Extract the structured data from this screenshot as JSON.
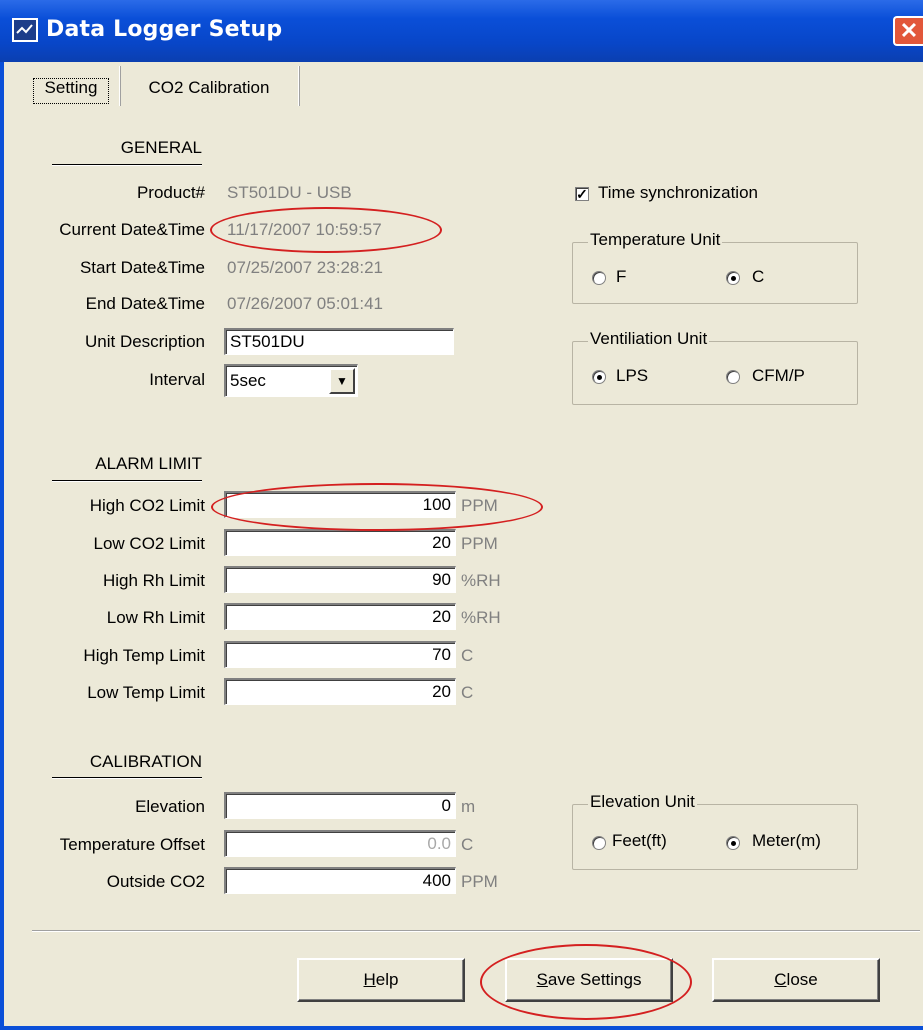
{
  "window": {
    "title": "Data Logger Setup",
    "close_glyph": "✕"
  },
  "tabs": [
    {
      "label": "Setting"
    },
    {
      "label": "CO2 Calibration"
    }
  ],
  "general": {
    "header": "GENERAL",
    "product_label": "Product#",
    "product_value": "ST501DU - USB",
    "current_label": "Current Date&Time",
    "current_value": "11/17/2007 10:59:57",
    "start_label": "Start Date&Time",
    "start_value": "07/25/2007 23:28:21",
    "end_label": "End Date&Time",
    "end_value": "07/26/2007 05:01:41",
    "unit_desc_label": "Unit Description",
    "unit_desc_value": "ST501DU",
    "interval_label": "Interval",
    "interval_value": "5sec"
  },
  "alarm": {
    "header": "ALARM LIMIT",
    "rows": [
      {
        "label": "High CO2 Limit",
        "value": "100",
        "unit": "PPM"
      },
      {
        "label": "Low CO2 Limit",
        "value": "20",
        "unit": "PPM"
      },
      {
        "label": "High Rh Limit",
        "value": "90",
        "unit": "%RH"
      },
      {
        "label": "Low Rh Limit",
        "value": "20",
        "unit": "%RH"
      },
      {
        "label": "High Temp Limit",
        "value": "70",
        "unit": "C"
      },
      {
        "label": "Low Temp Limit",
        "value": "20",
        "unit": "C"
      }
    ]
  },
  "calibration": {
    "header": "CALIBRATION",
    "rows": [
      {
        "label": "Elevation",
        "value": "0",
        "unit": "m"
      },
      {
        "label": "Temperature Offset",
        "value": "0.0",
        "unit": "C"
      },
      {
        "label": "Outside CO2",
        "value": "400",
        "unit": "PPM"
      }
    ]
  },
  "options": {
    "time_sync_label": "Time synchronization",
    "time_sync_checked": true,
    "temperature_unit": {
      "title": "Temperature Unit",
      "options": [
        "F",
        "C"
      ],
      "selected": "C"
    },
    "ventilation_unit": {
      "title": "Ventiliation Unit",
      "options": [
        "LPS",
        "CFM/P"
      ],
      "selected": "LPS"
    },
    "elevation_unit": {
      "title": "Elevation Unit",
      "options": [
        "Feet(ft)",
        "Meter(m)"
      ],
      "selected": "Meter(m)"
    }
  },
  "buttons": {
    "help_mnemonic": "H",
    "help_rest": "elp",
    "save_mnemonic": "S",
    "save_rest": "ave Settings",
    "close_mnemonic": "C",
    "close_rest": "lose"
  },
  "colors": {
    "title_bar": "#0a4fd8",
    "dialog_bg": "#ece9d8",
    "annotation_ellipse": "#d42020",
    "disabled_text": "#808080"
  }
}
